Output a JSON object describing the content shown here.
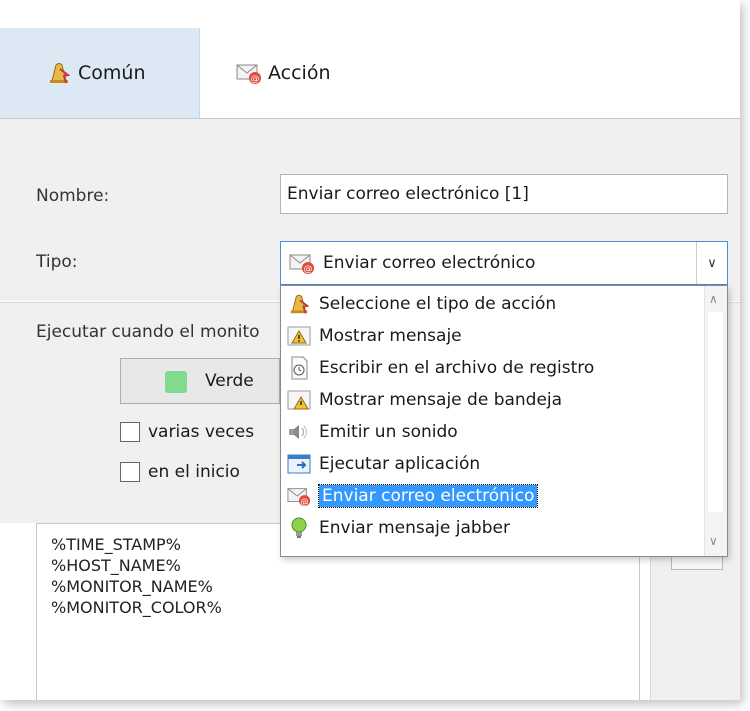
{
  "tabs": [
    {
      "label": "Común",
      "icon": "bell-alert-icon",
      "active": true
    },
    {
      "label": "Acción",
      "icon": "mail-icon",
      "active": false
    }
  ],
  "form": {
    "name_label": "Nombre:",
    "name_value": "Enviar correo electrónico [1]",
    "type_label": "Tipo:",
    "type_value": "Enviar correo electrónico",
    "execute_label": "Ejecutar cuando el monito",
    "color_button_label": "Verde",
    "checkbox_multiple": "varias veces",
    "checkbox_start": "en el inicio"
  },
  "message_body": "%TIME_STAMP%\n%HOST_NAME%\n%MONITOR_NAME%\n%MONITOR_COLOR%",
  "dropdown": {
    "items": [
      {
        "label": "Seleccione el tipo de acción",
        "icon": "bell-alert-icon"
      },
      {
        "label": "Mostrar mensaje",
        "icon": "warning-icon"
      },
      {
        "label": "Escribir en el archivo de registro",
        "icon": "log-file-icon"
      },
      {
        "label": "Mostrar mensaje de bandeja",
        "icon": "tray-warning-icon"
      },
      {
        "label": "Emitir un sonido",
        "icon": "speaker-icon"
      },
      {
        "label": "Ejecutar aplicación",
        "icon": "run-app-icon"
      },
      {
        "label": "Enviar correo electrónico",
        "icon": "mail-icon",
        "selected": true
      },
      {
        "label": "Enviar mensaje jabber",
        "icon": "jabber-bulb-icon"
      }
    ]
  },
  "colors": {
    "accent": "#3399ff",
    "tab_active_bg": "#dde8f5",
    "green_swatch": "#7fdc8a"
  }
}
